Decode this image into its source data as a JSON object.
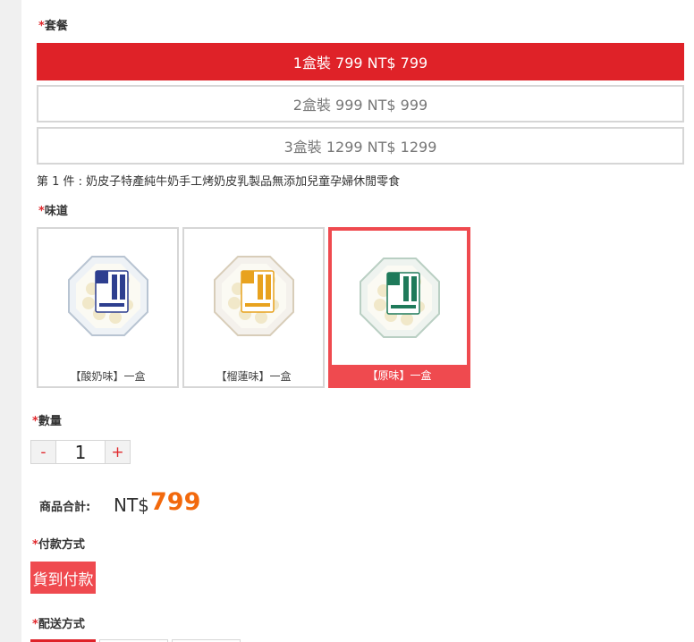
{
  "package": {
    "label": "套餐",
    "options": [
      {
        "label": "1盒裝 799 NT$ 799",
        "selected": true
      },
      {
        "label": "2盒裝 999 NT$ 999",
        "selected": false
      },
      {
        "label": "3盒裝 1299 NT$ 1299",
        "selected": false
      }
    ],
    "description": "第 1 件 : 奶皮子特產純牛奶手工烤奶皮乳製品無添加兒童孕婦休閒零食"
  },
  "flavor": {
    "label": "味道",
    "options": [
      {
        "label": "【酸奶味】一盒",
        "selected": false,
        "accent": "#2d3e8f"
      },
      {
        "label": "【榴蓮味】一盒",
        "selected": false,
        "accent": "#e8a21e"
      },
      {
        "label": "【原味】一盒",
        "selected": true,
        "accent": "#1f7a5a"
      }
    ]
  },
  "quantity": {
    "label": "數量",
    "minus": "-",
    "value": "1",
    "plus": "+"
  },
  "total": {
    "label": "商品合計:",
    "currency": "NT$",
    "amount": "799"
  },
  "payment": {
    "label": "付款方式",
    "option": "貨到付款"
  },
  "shipping": {
    "label": "配送方式"
  },
  "required_mark": "*",
  "colors": {
    "accent": "#df2228",
    "price": "#f2690d"
  }
}
